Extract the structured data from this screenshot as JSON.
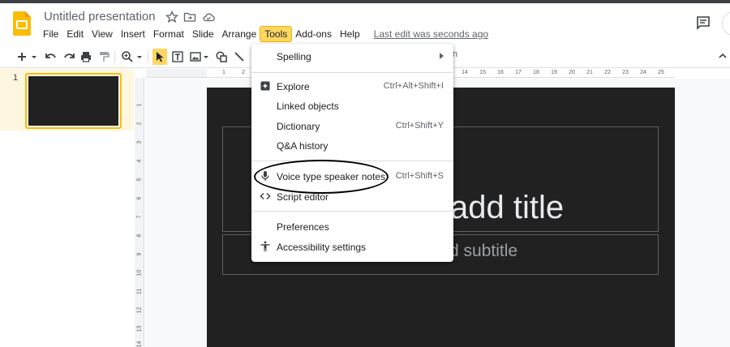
{
  "app": {
    "title": "Untitled presentation",
    "logo_icon": "slides-logo-icon",
    "accent": "#fbbc04"
  },
  "menubar": {
    "items": [
      {
        "label": "File",
        "active": false
      },
      {
        "label": "Edit",
        "active": false
      },
      {
        "label": "View",
        "active": false
      },
      {
        "label": "Insert",
        "active": false
      },
      {
        "label": "Format",
        "active": false
      },
      {
        "label": "Slide",
        "active": false
      },
      {
        "label": "Arrange",
        "active": false
      },
      {
        "label": "Tools",
        "active": true
      },
      {
        "label": "Add-ons",
        "active": false
      },
      {
        "label": "Help",
        "active": false
      }
    ],
    "last_edit": "Last edit was seconds ago"
  },
  "toolbar": {
    "partial_text": "n"
  },
  "filmstrip": {
    "slides": [
      {
        "number": "1"
      }
    ]
  },
  "ruler": {
    "horizontal": [
      "1",
      "2",
      "14",
      "15",
      "16",
      "17",
      "18",
      "19",
      "20",
      "21",
      "22",
      "23",
      "24",
      "25"
    ],
    "vertical": [
      "1",
      "2",
      "3",
      "4",
      "5",
      "6",
      "7",
      "8",
      "9",
      "10",
      "11",
      "12",
      "13",
      "14"
    ]
  },
  "slide": {
    "title_visible": "add title",
    "subtitle_visible": "d subtitle",
    "background": "#212121"
  },
  "tools_menu": {
    "items": [
      {
        "label": "Spelling",
        "shortcut": "",
        "icon": "",
        "submenu": true
      },
      {
        "label": "Explore",
        "shortcut": "Ctrl+Alt+Shift+I",
        "icon": "explore-icon",
        "submenu": false
      },
      {
        "label": "Linked objects",
        "shortcut": "",
        "icon": "",
        "submenu": false
      },
      {
        "label": "Dictionary",
        "shortcut": "Ctrl+Shift+Y",
        "icon": "",
        "submenu": false
      },
      {
        "label": "Q&A history",
        "shortcut": "",
        "icon": "",
        "submenu": false
      },
      {
        "label": "Voice type speaker notes",
        "shortcut": "Ctrl+Shift+S",
        "icon": "microphone-icon",
        "submenu": false
      },
      {
        "label": "Script editor",
        "shortcut": "",
        "icon": "code-icon",
        "submenu": false
      },
      {
        "label": "Preferences",
        "shortcut": "",
        "icon": "",
        "submenu": false
      },
      {
        "label": "Accessibility settings",
        "shortcut": "",
        "icon": "accessibility-icon",
        "submenu": false
      }
    ]
  }
}
